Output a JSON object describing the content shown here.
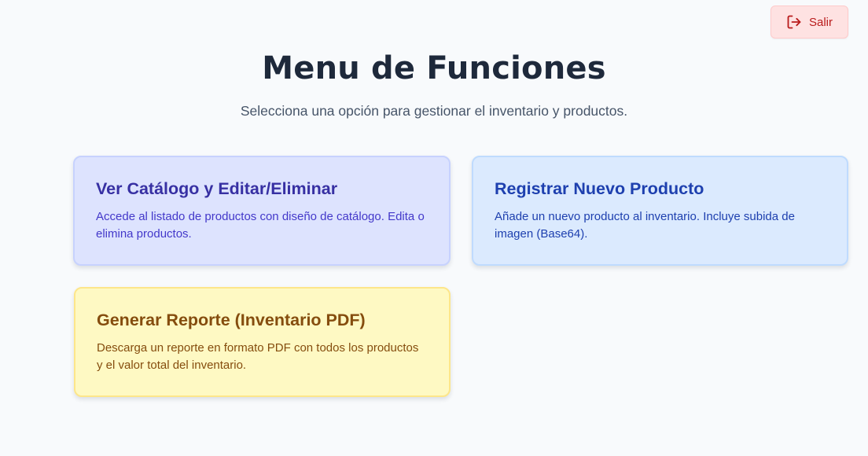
{
  "header": {
    "logout_label": "Salir",
    "logout_icon": "logout-icon",
    "title": "Menu de Funciones",
    "subtitle": "Selecciona una opción para gestionar el inventario y productos."
  },
  "cards": [
    {
      "title": "Ver Catálogo y Editar/Eliminar",
      "description": "Accede al listado de productos con diseño de catálogo. Edita o elimina productos.",
      "color": "#dde3fe"
    },
    {
      "title": "Registrar Nuevo Producto",
      "description": "Añade un nuevo producto al inventario. Incluye subida de imagen (Base64).",
      "color": "#dbeafe"
    },
    {
      "title": "Generar Reporte (Inventario PDF)",
      "description": "Descarga un reporte en formato PDF con todos los productos y el valor total del inventario.",
      "color": "#fef9c3"
    }
  ],
  "colors": {
    "background": "#f8fafc",
    "logout_bg": "#fee2e2",
    "logout_text": "#b91c1c"
  }
}
